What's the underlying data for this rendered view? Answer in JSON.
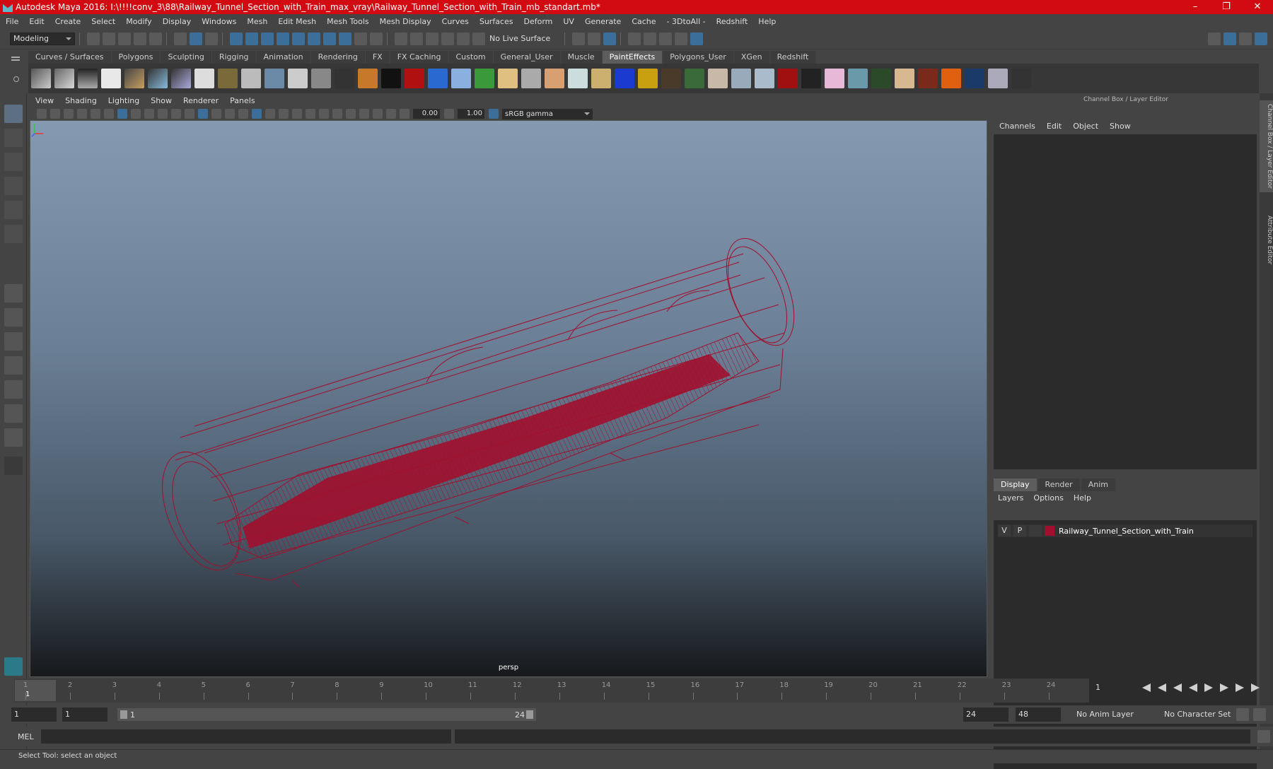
{
  "window": {
    "title": "Autodesk Maya 2016: I:\\!!!!conv_3\\88\\Railway_Tunnel_Section_with_Train_max_vray\\Railway_Tunnel_Section_with_Train_mb_standart.mb*"
  },
  "menubar": [
    "File",
    "Edit",
    "Create",
    "Select",
    "Modify",
    "Display",
    "Windows",
    "Mesh",
    "Edit Mesh",
    "Mesh Tools",
    "Mesh Display",
    "Curves",
    "Surfaces",
    "Deform",
    "UV",
    "Generate",
    "Cache",
    "- 3DtoAll -",
    "Redshift",
    "Help"
  ],
  "status": {
    "mode": "Modeling",
    "live_surface": "No Live Surface"
  },
  "shelf_tabs": [
    "Curves / Surfaces",
    "Polygons",
    "Sculpting",
    "Rigging",
    "Animation",
    "Rendering",
    "FX",
    "FX Caching",
    "Custom",
    "General_User",
    "Muscle",
    "PaintEffects",
    "Polygons_User",
    "XGen",
    "Redshift"
  ],
  "active_shelf_tab": "PaintEffects",
  "viewport": {
    "menu": [
      "View",
      "Shading",
      "Lighting",
      "Show",
      "Renderer",
      "Panels"
    ],
    "field_a": "0.00",
    "field_b": "1.00",
    "color_mgmt": "sRGB gamma",
    "camera": "persp",
    "wire_color": "#a0102e"
  },
  "channel_box": {
    "header": "Channel Box / Layer Editor",
    "menu": [
      "Channels",
      "Edit",
      "Object",
      "Show"
    ]
  },
  "layer_editor": {
    "tabs": [
      "Display",
      "Render",
      "Anim"
    ],
    "menu": [
      "Layers",
      "Options",
      "Help"
    ],
    "layer": {
      "v": "V",
      "p": "P",
      "name": "Railway_Tunnel_Section_with_Train",
      "color": "#a0102e"
    }
  },
  "side_tabs": [
    "Channel Box / Layer Editor",
    "Attribute Editor"
  ],
  "timeline": {
    "ticks": [
      "1",
      "2",
      "3",
      "4",
      "5",
      "6",
      "7",
      "8",
      "9",
      "10",
      "11",
      "12",
      "13",
      "14",
      "15",
      "16",
      "17",
      "18",
      "19",
      "20",
      "21",
      "22",
      "23",
      "24"
    ],
    "current": "1",
    "current_field": "1"
  },
  "range": {
    "start": "1",
    "inner_start": "1",
    "slider_start": "1",
    "slider_end": "24",
    "end": "24",
    "outer_end": "48",
    "anim_layer": "No Anim Layer",
    "char_set": "No Character Set"
  },
  "cmd": {
    "lang": "MEL"
  },
  "help_line": "Select Tool: select an object"
}
